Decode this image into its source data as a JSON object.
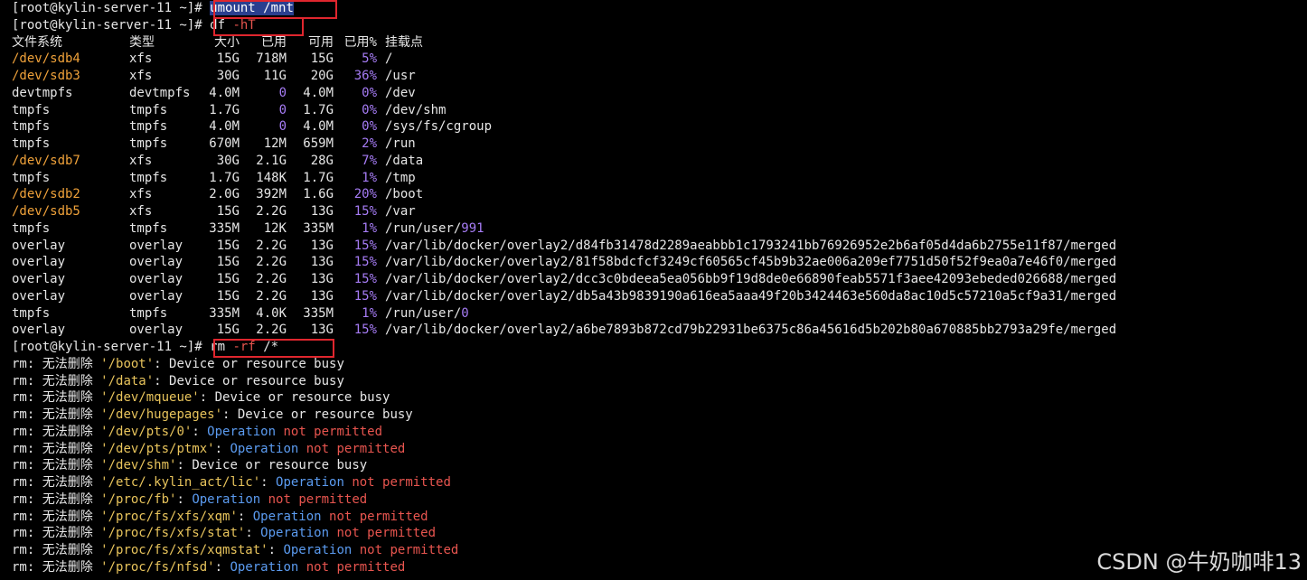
{
  "prompt": "[root@kylin-server-11 ~]# ",
  "commands": {
    "umount_cmd": "umount",
    "umount_arg": "/mnt",
    "df_cmd": "df",
    "df_arg": "-hT",
    "rm_cmd": "rm",
    "rm_flag": "-rf",
    "rm_arg": "/*"
  },
  "df_table": {
    "headers": [
      "文件系统",
      "类型",
      "大小",
      "已用",
      "可用",
      "已用%",
      "挂载点"
    ],
    "rows": [
      {
        "fs": "/dev/sdb4",
        "type": "xfs",
        "size": "15G",
        "used": "718M",
        "avail": "15G",
        "pct": "5%",
        "mount": "/"
      },
      {
        "fs": "/dev/sdb3",
        "type": "xfs",
        "size": "30G",
        "used": "11G",
        "avail": "20G",
        "pct": "36%",
        "mount": "/usr"
      },
      {
        "fs": "devtmpfs",
        "type": "devtmpfs",
        "size": "4.0M",
        "used": "0",
        "avail": "4.0M",
        "pct": "0%",
        "mount": "/dev"
      },
      {
        "fs": "tmpfs",
        "type": "tmpfs",
        "size": "1.7G",
        "used": "0",
        "avail": "1.7G",
        "pct": "0%",
        "mount": "/dev/shm"
      },
      {
        "fs": "tmpfs",
        "type": "tmpfs",
        "size": "4.0M",
        "used": "0",
        "avail": "4.0M",
        "pct": "0%",
        "mount": "/sys/fs/cgroup"
      },
      {
        "fs": "tmpfs",
        "type": "tmpfs",
        "size": "670M",
        "used": "12M",
        "avail": "659M",
        "pct": "2%",
        "mount": "/run"
      },
      {
        "fs": "/dev/sdb7",
        "type": "xfs",
        "size": "30G",
        "used": "2.1G",
        "avail": "28G",
        "pct": "7%",
        "mount": "/data"
      },
      {
        "fs": "tmpfs",
        "type": "tmpfs",
        "size": "1.7G",
        "used": "148K",
        "avail": "1.7G",
        "pct": "1%",
        "mount": "/tmp"
      },
      {
        "fs": "/dev/sdb2",
        "type": "xfs",
        "size": "2.0G",
        "used": "392M",
        "avail": "1.6G",
        "pct": "20%",
        "mount": "/boot"
      },
      {
        "fs": "/dev/sdb5",
        "type": "xfs",
        "size": "15G",
        "used": "2.2G",
        "avail": "13G",
        "pct": "15%",
        "mount": "/var"
      },
      {
        "fs": "tmpfs",
        "type": "tmpfs",
        "size": "335M",
        "used": "12K",
        "avail": "335M",
        "pct": "1%",
        "mount": "/run/user/991"
      },
      {
        "fs": "overlay",
        "type": "overlay",
        "size": "15G",
        "used": "2.2G",
        "avail": "13G",
        "pct": "15%",
        "mount": "/var/lib/docker/overlay2/d84fb31478d2289aeabbb1c1793241bb76926952e2b6af05d4da6b2755e11f87/merged"
      },
      {
        "fs": "overlay",
        "type": "overlay",
        "size": "15G",
        "used": "2.2G",
        "avail": "13G",
        "pct": "15%",
        "mount": "/var/lib/docker/overlay2/81f58bdcfcf3249cf60565cf45b9b32ae006a209ef7751d50f52f9ea0a7e46f0/merged"
      },
      {
        "fs": "overlay",
        "type": "overlay",
        "size": "15G",
        "used": "2.2G",
        "avail": "13G",
        "pct": "15%",
        "mount": "/var/lib/docker/overlay2/dcc3c0bdeea5ea056bb9f19d8de0e66890feab5571f3aee42093ebeded026688/merged"
      },
      {
        "fs": "overlay",
        "type": "overlay",
        "size": "15G",
        "used": "2.2G",
        "avail": "13G",
        "pct": "15%",
        "mount": "/var/lib/docker/overlay2/db5a43b9839190a616ea5aaa49f20b3424463e560da8ac10d5c57210a5cf9a31/merged"
      },
      {
        "fs": "tmpfs",
        "type": "tmpfs",
        "size": "335M",
        "used": "4.0K",
        "avail": "335M",
        "pct": "1%",
        "mount": "/run/user/0"
      },
      {
        "fs": "overlay",
        "type": "overlay",
        "size": "15G",
        "used": "2.2G",
        "avail": "13G",
        "pct": "15%",
        "mount": "/var/lib/docker/overlay2/a6be7893b872cd79b22931be6375c86a45616d5b202b80a670885bb2793a29fe/merged"
      }
    ]
  },
  "rm_errors": [
    {
      "prefix": "rm: 无法删除 ",
      "path": "'/boot'",
      "sep": ": ",
      "msg": "Device or resource busy",
      "kind": "busy"
    },
    {
      "prefix": "rm: 无法删除 ",
      "path": "'/data'",
      "sep": ": ",
      "msg": "Device or resource busy",
      "kind": "busy"
    },
    {
      "prefix": "rm: 无法删除 ",
      "path": "'/dev/mqueue'",
      "sep": ": ",
      "msg": "Device or resource busy",
      "kind": "busy"
    },
    {
      "prefix": "rm: 无法删除 ",
      "path": "'/dev/hugepages'",
      "sep": ": ",
      "msg": "Device or resource busy",
      "kind": "busy"
    },
    {
      "prefix": "rm: 无法删除 ",
      "path": "'/dev/pts/0'",
      "sep": ": ",
      "msg": "Operation not permitted",
      "kind": "perm"
    },
    {
      "prefix": "rm: 无法删除 ",
      "path": "'/dev/pts/ptmx'",
      "sep": ": ",
      "msg": "Operation not permitted",
      "kind": "perm"
    },
    {
      "prefix": "rm: 无法删除 ",
      "path": "'/dev/shm'",
      "sep": ": ",
      "msg": "Device or resource busy",
      "kind": "busy"
    },
    {
      "prefix": "rm: 无法删除 ",
      "path": "'/etc/.kylin_act/lic'",
      "sep": ": ",
      "msg": "Operation not permitted",
      "kind": "perm"
    },
    {
      "prefix": "rm: 无法删除 ",
      "path": "'/proc/fb'",
      "sep": ": ",
      "msg": "Operation not permitted",
      "kind": "perm"
    },
    {
      "prefix": "rm: 无法删除 ",
      "path": "'/proc/fs/xfs/xqm'",
      "sep": ": ",
      "msg": "Operation not permitted",
      "kind": "perm"
    },
    {
      "prefix": "rm: 无法删除 ",
      "path": "'/proc/fs/xfs/stat'",
      "sep": ": ",
      "msg": "Operation not permitted",
      "kind": "perm"
    },
    {
      "prefix": "rm: 无法删除 ",
      "path": "'/proc/fs/xfs/xqmstat'",
      "sep": ": ",
      "msg": "Operation not permitted",
      "kind": "perm"
    },
    {
      "prefix": "rm: 无法删除 ",
      "path": "'/proc/fs/nfsd'",
      "sep": ": ",
      "msg": "Operation not permitted",
      "kind": "perm"
    }
  ],
  "watermark": "CSDN @牛奶咖啡13",
  "colors": {
    "background": "#000000",
    "text": "#e6e6e6",
    "device_path": "#f0a23a",
    "number": "#a67cf5",
    "error": "#e8554f",
    "keyword": "#5b9bf0",
    "quoted": "#e8c45c",
    "highlight_box": "#e0262e"
  }
}
